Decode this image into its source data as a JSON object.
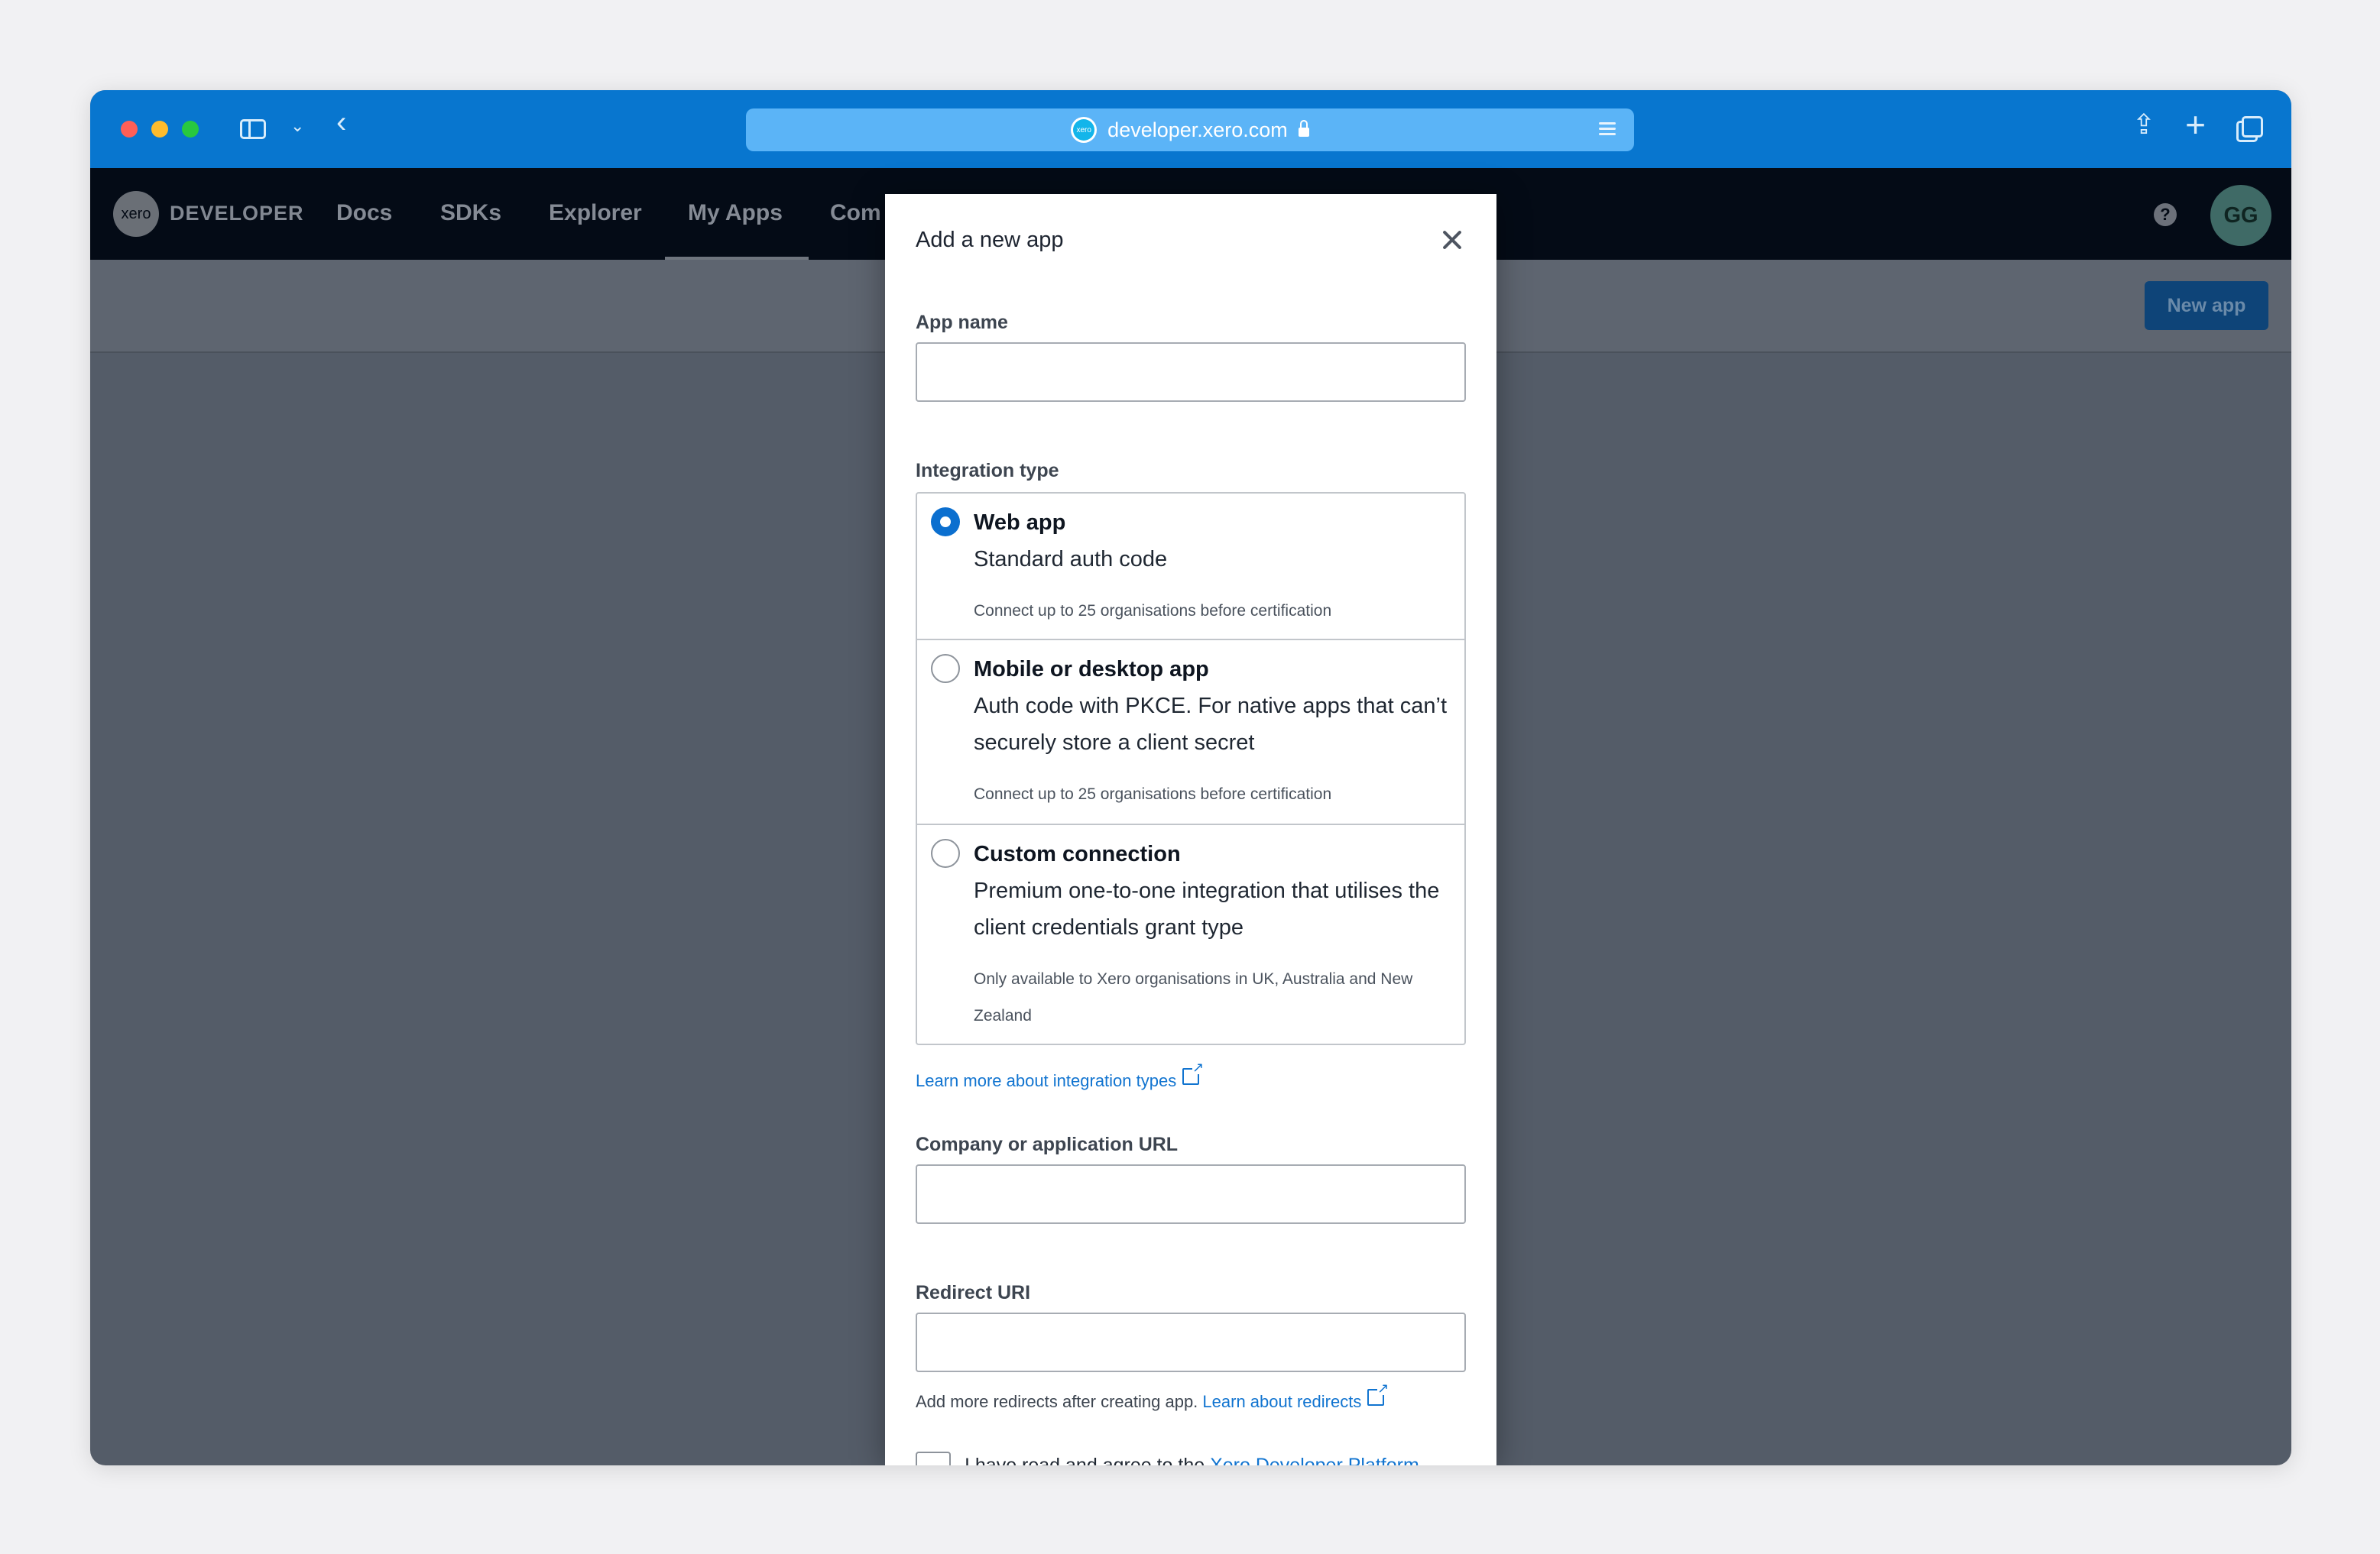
{
  "browser": {
    "url": "developer.xero.com",
    "logo_text": "xero"
  },
  "nav": {
    "logo_text": "xero",
    "brand": "DEVELOPER",
    "items": [
      "Docs",
      "SDKs",
      "Explorer",
      "My Apps",
      "Com"
    ],
    "active_item": "My Apps",
    "help_icon": "?",
    "avatar_initials": "GG"
  },
  "subbar": {
    "new_app_button": "New app"
  },
  "modal": {
    "title": "Add a new app",
    "app_name_label": "App name",
    "app_name_value": "",
    "integration_type_label": "Integration type",
    "options": [
      {
        "title": "Web app",
        "description": "Standard auth code",
        "note": "Connect up to 25 organisations before certification",
        "selected": true
      },
      {
        "title": "Mobile or desktop app",
        "description": "Auth code with PKCE. For native apps that can’t securely store a client secret",
        "note": "Connect up to 25 organisations before certification",
        "selected": false
      },
      {
        "title": "Custom connection",
        "description": "Premium one-to-one integration that utilises the client credentials grant type",
        "note": "Only available to Xero organisations in UK, Australia and New Zealand",
        "selected": false
      }
    ],
    "learn_more_link": "Learn more about integration types",
    "company_url_label": "Company or application URL",
    "company_url_value": "",
    "redirect_uri_label": "Redirect URI",
    "redirect_uri_value": "",
    "redirect_help_text": "Add more redirects after creating app.",
    "redirect_help_link": "Learn about redirects",
    "agree_text": "I have read and agree to the",
    "agree_link": "Xero Developer Platform"
  }
}
